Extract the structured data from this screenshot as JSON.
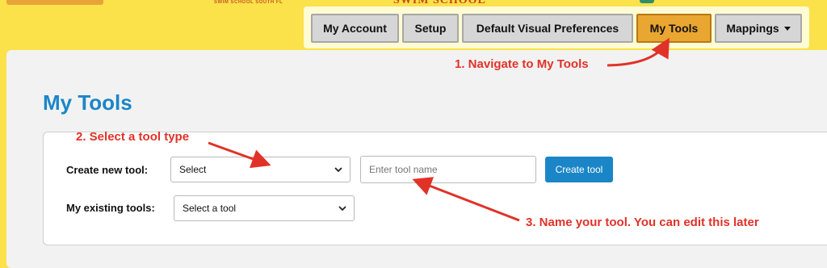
{
  "logo": {
    "small_text": "SWIM SCHOOL SOUTH FL",
    "name": "SWIM SCHOOL"
  },
  "nav": {
    "items": [
      {
        "label": "My Account"
      },
      {
        "label": "Setup"
      },
      {
        "label": "Default Visual Preferences"
      },
      {
        "label": "My Tools",
        "active": true
      },
      {
        "label": "Mappings"
      }
    ]
  },
  "page": {
    "title": "My Tools",
    "create_label": "Create new tool:",
    "tool_type_select": "Select",
    "tool_name_placeholder": "Enter tool name",
    "create_button": "Create tool",
    "existing_label": "My existing tools:",
    "existing_select": "Select a tool"
  },
  "annotations": {
    "step1": "1. Navigate to My Tools",
    "step2": "2. Select a tool type",
    "step3": "3. Name your tool. You can edit this later"
  },
  "colors": {
    "background": "#fbe14a",
    "accent_blue": "#1a86c7",
    "active_tab": "#e9a631",
    "annotation_red": "#e13228"
  },
  "icons": {
    "dropdown_caret": "chevron-down-icon",
    "menu_caret": "caret-down-icon"
  }
}
